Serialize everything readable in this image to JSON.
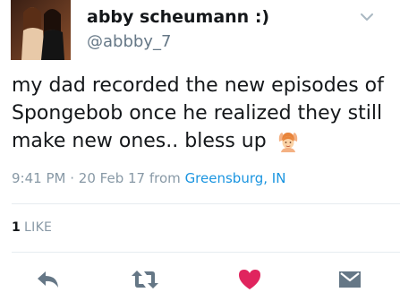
{
  "tweet": {
    "display_name": "abby scheumann :)",
    "handle": "@abbby_7",
    "text": "my dad recorded the new episodes of Spongebob once he realized they still make new ones.. bless up",
    "emoji_icon": "person-raising-both-hands-icon",
    "time": "9:41 PM",
    "separator": "·",
    "date": "20 Feb 17",
    "from_label": "from",
    "location": "Greensburg, IN",
    "like_count": "1",
    "like_label": "LIKE"
  },
  "actions": {
    "reply_icon": "reply-icon",
    "retweet_icon": "retweet-icon",
    "like_icon": "heart-icon",
    "dm_icon": "envelope-icon"
  },
  "colors": {
    "text": "#14171a",
    "muted": "#8899a6",
    "link": "#1b95e0",
    "heart": "#e0245e"
  }
}
